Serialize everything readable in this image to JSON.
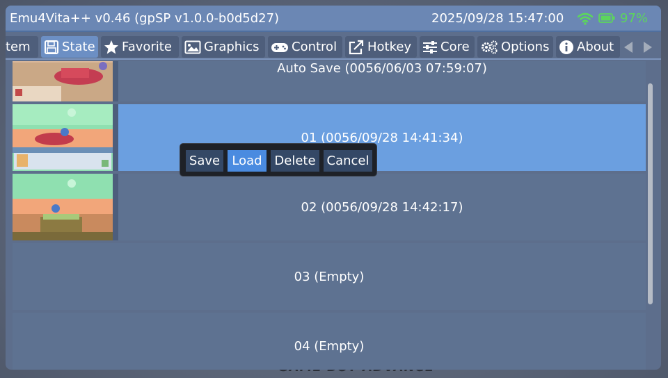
{
  "titlebar": {
    "title": "Emu4Vita++ v0.46 (gpSP v1.0.0-b0d5d27)",
    "clock": "2025/09/28 15:47:00",
    "battery": "97%",
    "battery_color": "#5cd65c"
  },
  "tabs": [
    {
      "label": "tem",
      "icon": "system-icon"
    },
    {
      "label": "State",
      "icon": "save-disk-icon",
      "active": true
    },
    {
      "label": "Favorite",
      "icon": "star-icon"
    },
    {
      "label": "Graphics",
      "icon": "image-icon"
    },
    {
      "label": "Control",
      "icon": "gamepad-icon"
    },
    {
      "label": "Hotkey",
      "icon": "external-link-icon"
    },
    {
      "label": "Core",
      "icon": "sliders-icon"
    },
    {
      "label": "Options",
      "icon": "gears-icon"
    },
    {
      "label": "About",
      "icon": "info-icon"
    }
  ],
  "states": [
    {
      "label": "Auto Save (0056/06/03 07:59:07)",
      "has_thumbnail": true
    },
    {
      "label": "01 (0056/09/28 14:41:34)",
      "has_thumbnail": true,
      "selected": true
    },
    {
      "label": "02 (0056/09/28 14:42:17)",
      "has_thumbnail": true
    },
    {
      "label": "03 (Empty)",
      "has_thumbnail": false
    },
    {
      "label": "04 (Empty)",
      "has_thumbnail": false
    }
  ],
  "popup": {
    "save": "Save",
    "load": "Load",
    "delete": "Delete",
    "cancel": "Cancel",
    "active": "load"
  },
  "accent_color": "#6b9fe0"
}
